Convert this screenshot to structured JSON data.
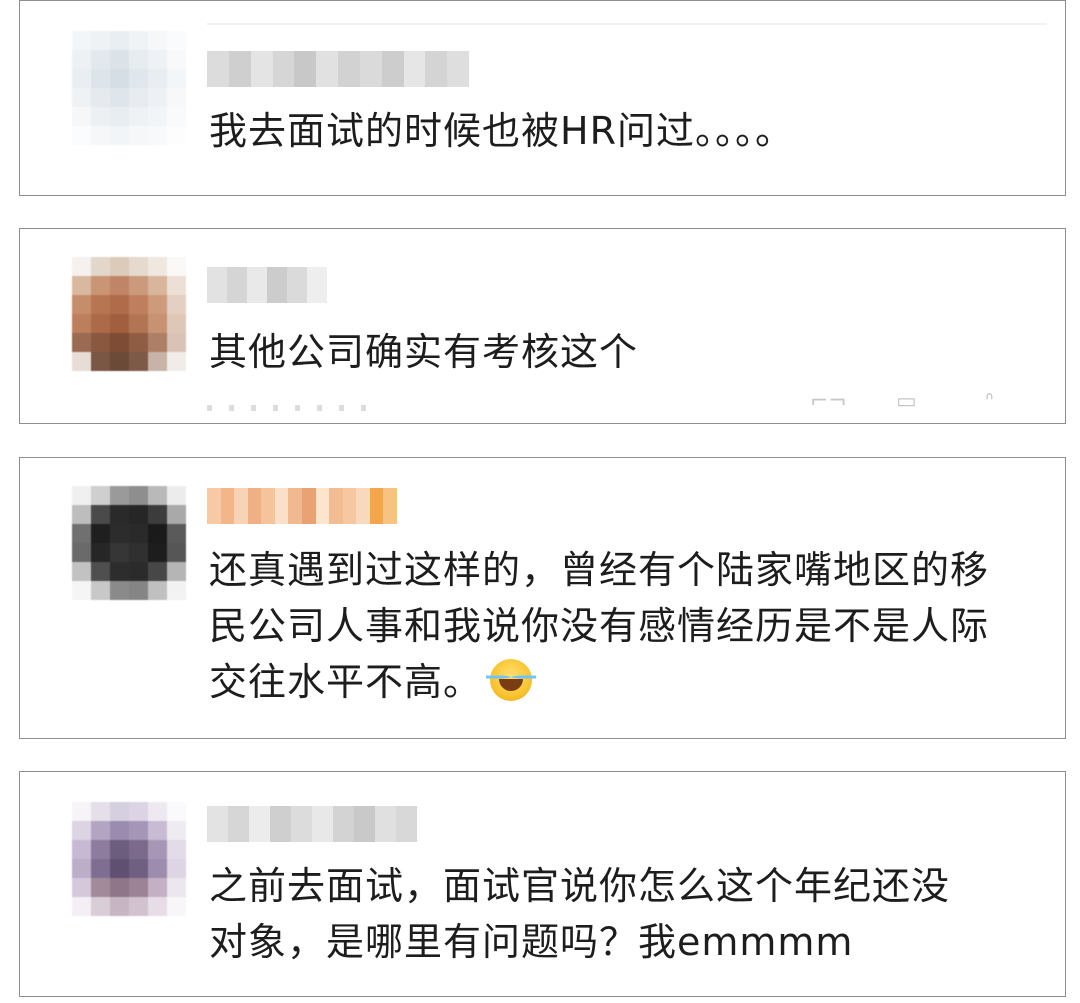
{
  "comments": [
    {
      "username": "",
      "text": "我去面试的时候也被HR问过。。。。",
      "avatar_colors": [
        "#f3f6f8",
        "#eef2f5",
        "#e9eef2",
        "#f0f3f6",
        "#f5f7f9",
        "#fafbfc",
        "#edf1f4",
        "#e2e8ed",
        "#dbe2e8",
        "#e6ecf0",
        "#eef2f5",
        "#f7f9fa",
        "#e9eef2",
        "#dde4ea",
        "#d6dee5",
        "#e0e7ec",
        "#e8edf1",
        "#f3f6f8",
        "#eef2f5",
        "#e4eaee",
        "#dfe6eb",
        "#e7ecf0",
        "#edf1f4",
        "#f6f8fa",
        "#f5f7f9",
        "#ecf0f3",
        "#e8edf1",
        "#eef2f5",
        "#f2f5f7",
        "#f9fafb",
        "#fbfcfd",
        "#f5f7f9",
        "#f2f5f7",
        "#f5f7f9",
        "#f8f9fa",
        "#fdfdfe"
      ],
      "username_colors": [
        "#dcdcdc",
        "#cfcfcf",
        "#e4e4e4",
        "#d6d6d6",
        "#c8c8c8",
        "#e1e1e1",
        "#d2d2d2",
        "#dadada",
        "#cdcdcd",
        "#e6e6e6",
        "#d4d4d4",
        "#dedede"
      ]
    },
    {
      "username": "",
      "text": "其他公司确实有考核这个",
      "avatar_colors": [
        "#f4f1ee",
        "#e3d7cc",
        "#dccbbb",
        "#e6d9ce",
        "#efe8e1",
        "#fbf9f7",
        "#d9b8a0",
        "#c99574",
        "#c08566",
        "#cb9a7c",
        "#d8b59b",
        "#ece0d6",
        "#c68d6b",
        "#b87552",
        "#b06c4a",
        "#bf7f5e",
        "#cd9a7b",
        "#e4d0c2",
        "#bb7f5d",
        "#ad6a48",
        "#a25f3f",
        "#b27554",
        "#c69272",
        "#dfc7b7",
        "#9a6a52",
        "#8a573f",
        "#7e4c35",
        "#8f5d44",
        "#ad7f67",
        "#d8c3b6",
        "#e8ddd6",
        "#7a5644",
        "#6c4a38",
        "#7d5947",
        "#c7b3a8",
        "#f2ece8"
      ],
      "username_colors": [
        "#e2e2e2",
        "#d5d5d5",
        "#e9e9e9",
        "#cccccc",
        "#dadada",
        "#eeeeee"
      ]
    },
    {
      "username": "",
      "text": "还真遇到过这样的，曾经有个陆家嘴地区的移民公司人事和我说你没有感情经历是不是人际交往水平不高。",
      "emoji": "😂",
      "avatar_colors": [
        "#f0f0f0",
        "#cfcfcf",
        "#9a9a9a",
        "#8e8e8e",
        "#b9b9b9",
        "#ececec",
        "#bdbdbd",
        "#4a4a4a",
        "#2a2a2a",
        "#262626",
        "#3c3c3c",
        "#a9a9a9",
        "#707070",
        "#1f1f1f",
        "#2c2c2c",
        "#2a2a2a",
        "#1a1a1a",
        "#5a5a5a",
        "#6a6a6a",
        "#262626",
        "#363636",
        "#303030",
        "#1d1d1d",
        "#565656",
        "#c2c2c2",
        "#4f4f4f",
        "#2d2d2d",
        "#2b2b2b",
        "#474747",
        "#b5b5b5",
        "#f5f5f5",
        "#c8c8c8",
        "#8a8a8a",
        "#858585",
        "#c0c0c0",
        "#f2f2f2"
      ],
      "username_colors": [
        "#f7c9a4",
        "#f2b68a",
        "#f8d4b6",
        "#efb085",
        "#f5c39c",
        "#fae0c8",
        "#f0b98f",
        "#e8a273",
        "#fde4cd",
        "#f3bd93",
        "#f6c7a0",
        "#f9d9bd",
        "#f4a64a",
        "#f7c383"
      ]
    },
    {
      "username": "",
      "text": "之前去面试，面试官说你怎么这个年纪还没对象，是哪里有问题吗？我emmmm",
      "avatar_colors": [
        "#f6f4f7",
        "#e4dfe8",
        "#d6cfe0",
        "#dcd4e4",
        "#eee9f1",
        "#faf9fb",
        "#dcd3e3",
        "#b3a5c2",
        "#9b8caf",
        "#a596b8",
        "#c8bcd4",
        "#eeebf1",
        "#c7b9d3",
        "#8d7c9e",
        "#6c5c7e",
        "#7b6a8c",
        "#a896b6",
        "#e2dbe8",
        "#bcaec9",
        "#7f6e91",
        "#5f4f70",
        "#6f5f80",
        "#9e8cae",
        "#ddd4e4",
        "#d5c8db",
        "#a28a9b",
        "#8f7688",
        "#9c8396",
        "#c3b0c4",
        "#ece6ef",
        "#f3eff4",
        "#d9cdd8",
        "#c7b5c4",
        "#d2c2cf",
        "#e6dde7",
        "#f8f6f9"
      ],
      "username_colors": [
        "#e3e3e3",
        "#d6d6d6",
        "#ececec",
        "#cfcfcf",
        "#dcdcdc",
        "#e8e8e8",
        "#d3d3d3",
        "#c9c9c9",
        "#e0e0e0",
        "#d8d8d8"
      ]
    }
  ]
}
